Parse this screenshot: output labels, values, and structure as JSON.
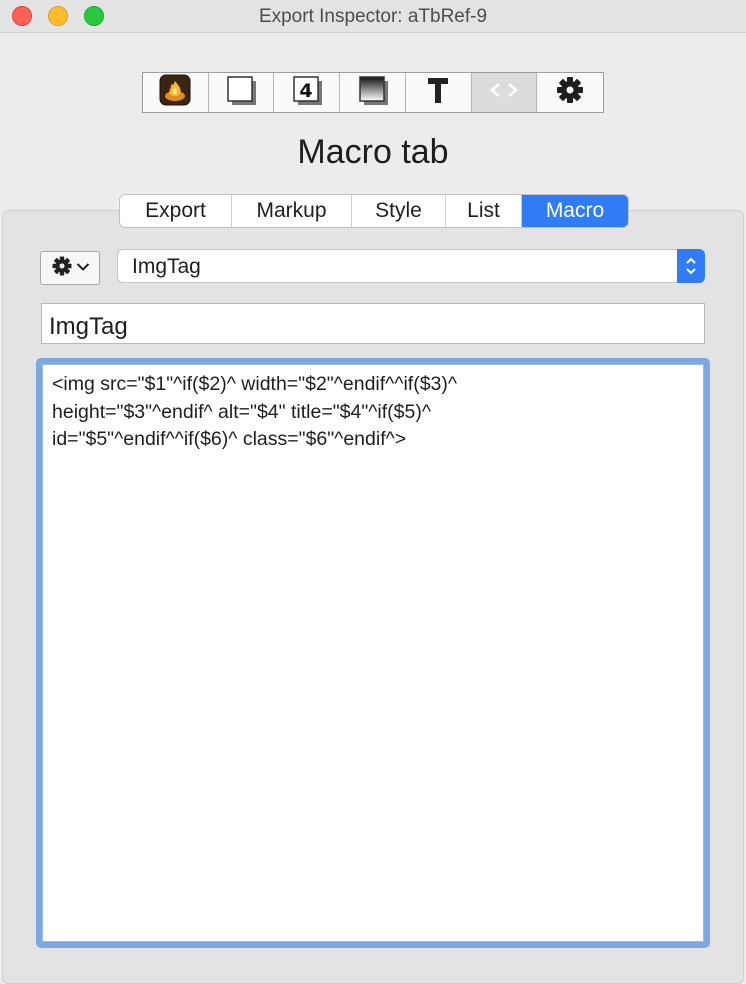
{
  "window": {
    "title": "Export Inspector: aTbRef-9"
  },
  "toolbar": {
    "buttons": [
      {
        "icon": "flame-icon"
      },
      {
        "icon": "page-icon"
      },
      {
        "icon": "badge-4-icon"
      },
      {
        "icon": "gradient-page-icon"
      },
      {
        "icon": "text-t-icon"
      },
      {
        "icon": "code-brackets-icon",
        "selected": true
      },
      {
        "icon": "gear-icon"
      }
    ]
  },
  "page": {
    "title": "Macro tab"
  },
  "tabs": [
    {
      "label": "Export"
    },
    {
      "label": "Markup"
    },
    {
      "label": "Style"
    },
    {
      "label": "List"
    },
    {
      "label": "Macro",
      "active": true
    }
  ],
  "macro": {
    "selected": "ImgTag",
    "name": "ImgTag",
    "content": "<img src=\"$1\"^if($2)^ width=\"$2\"^endif^^if($3)^\nheight=\"$3\"^endif^ alt=\"$4\" title=\"$4\"^if($5)^\nid=\"$5\"^endif^^if($6)^ class=\"$6\"^endif^>"
  },
  "colors": {
    "accent": "#2f7cf6",
    "focus_ring": "#7fa8e3",
    "close": "#fe5f57",
    "minimize": "#febc2e",
    "maximize": "#28c840"
  }
}
